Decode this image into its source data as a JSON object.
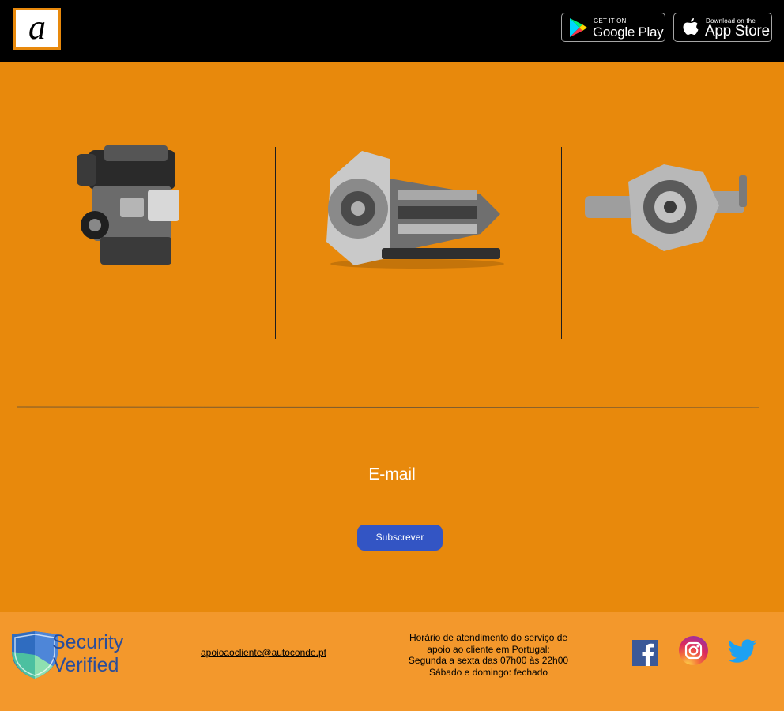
{
  "header": {
    "logo_letter": "a",
    "google_play": {
      "small": "GET IT ON",
      "big": "Google Play"
    },
    "app_store": {
      "small": "Download on the",
      "big": "App Store"
    }
  },
  "products": {
    "images": [
      "engine-image",
      "transmission-image",
      "differential-image"
    ]
  },
  "newsletter": {
    "email_label": "E-mail",
    "subscribe_label": "Subscrever"
  },
  "footer": {
    "security_line1": "Security",
    "security_line2": "Verified",
    "email": "apoioaocliente@autoconde.pt",
    "hours": [
      "Horário de atendimento do serviço de",
      "apoio ao cliente em Portugal:",
      "Segunda a sexta das 07h00 às 22h00",
      "Sábado e domingo: fechado"
    ],
    "social_icons": [
      "facebook-icon",
      "instagram-icon",
      "twitter-icon"
    ]
  },
  "colors": {
    "accent": "#e8890c",
    "footer_bg": "#f3982c",
    "header_bg": "#000000",
    "button": "#3355c4"
  }
}
